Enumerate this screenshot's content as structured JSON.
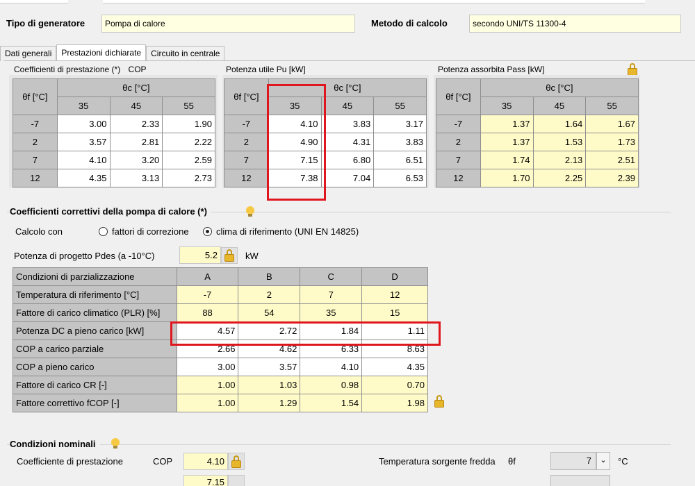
{
  "header": {
    "generator_label": "Tipo di generatore",
    "generator_value": "Pompa di calore",
    "method_label": "Metodo di calcolo",
    "method_value": "secondo UNI/TS 11300-4"
  },
  "tabs": [
    {
      "label": "Dati generali",
      "active": false
    },
    {
      "label": "Prestazioni dichiarate",
      "active": true
    },
    {
      "label": "Circuito in centrale",
      "active": false
    }
  ],
  "cop_table": {
    "title": "Coefficienti di prestazione (*)",
    "title_suffix": "COP",
    "row_header": "θf [°C]",
    "col_header": "θc [°C]",
    "cols": [
      "35",
      "45",
      "55"
    ],
    "rows": [
      {
        "label": "-7",
        "values": [
          "3.00",
          "2.33",
          "1.90"
        ]
      },
      {
        "label": "2",
        "values": [
          "3.57",
          "2.81",
          "2.22"
        ]
      },
      {
        "label": "7",
        "values": [
          "4.10",
          "3.20",
          "2.59"
        ]
      },
      {
        "label": "12",
        "values": [
          "4.35",
          "3.13",
          "2.73"
        ]
      }
    ]
  },
  "pu_table": {
    "title": "Potenza utile Pu [kW]",
    "row_header": "θf [°C]",
    "col_header": "θc [°C]",
    "cols": [
      "35",
      "45",
      "55"
    ],
    "rows": [
      {
        "label": "-7",
        "values": [
          "4.10",
          "3.83",
          "3.17"
        ]
      },
      {
        "label": "2",
        "values": [
          "4.90",
          "4.31",
          "3.83"
        ]
      },
      {
        "label": "7",
        "values": [
          "7.15",
          "6.80",
          "6.51"
        ]
      },
      {
        "label": "12",
        "values": [
          "7.38",
          "7.04",
          "6.53"
        ]
      }
    ]
  },
  "pass_table": {
    "title": "Potenza assorbita Pass [kW]",
    "row_header": "θf [°C]",
    "col_header": "θc [°C]",
    "cols": [
      "35",
      "45",
      "55"
    ],
    "rows": [
      {
        "label": "-7",
        "values": [
          "1.37",
          "1.64",
          "1.67"
        ]
      },
      {
        "label": "2",
        "values": [
          "1.37",
          "1.53",
          "1.73"
        ]
      },
      {
        "label": "7",
        "values": [
          "1.74",
          "2.13",
          "2.51"
        ]
      },
      {
        "label": "12",
        "values": [
          "1.70",
          "2.25",
          "2.39"
        ]
      }
    ]
  },
  "corrective": {
    "title": "Coefficienti correttivi della pompa di calore (*)",
    "calc_label": "Calcolo con",
    "option1": "fattori di correzione",
    "option2": "clima di riferimento (UNI EN 14825)",
    "selected_option": 2,
    "pdes_label": "Potenza di progetto Pdes (a -10°C)",
    "pdes_value": "5.2",
    "pdes_unit": "kW",
    "table": {
      "header_label": "Condizioni di parzializzazione",
      "cols": [
        "A",
        "B",
        "C",
        "D"
      ],
      "rows": [
        {
          "label": "Temperatura di riferimento [°C]",
          "values": [
            "-7",
            "2",
            "7",
            "12"
          ],
          "style": "yc"
        },
        {
          "label": "Fattore di carico climatico (PLR) [%]",
          "values": [
            "88",
            "54",
            "35",
            "15"
          ],
          "style": "yc"
        },
        {
          "label": "Potenza DC a pieno carico [kW]",
          "values": [
            "4.57",
            "2.72",
            "1.84",
            "1.11"
          ],
          "style": "wv"
        },
        {
          "label": "COP a carico parziale",
          "values": [
            "2.66",
            "4.62",
            "6.33",
            "8.63"
          ],
          "style": "wv"
        },
        {
          "label": "COP a pieno carico",
          "values": [
            "3.00",
            "3.57",
            "4.10",
            "4.35"
          ],
          "style": "wv"
        },
        {
          "label": "Fattore di carico CR [-]",
          "values": [
            "1.00",
            "1.03",
            "0.98",
            "0.70"
          ],
          "style": "yv"
        },
        {
          "label": "Fattore correttivo fCOP [-]",
          "values": [
            "1.00",
            "1.29",
            "1.54",
            "1.98"
          ],
          "style": "yv"
        }
      ]
    }
  },
  "nominal": {
    "title": "Condizioni nominali",
    "cop_label": "Coefficiente di prestazione",
    "cop_symbol": "COP",
    "cop_value": "4.10",
    "tsource_label": "Temperatura sorgente fredda",
    "tsource_symbol": "θf",
    "tsource_value": "7",
    "tsource_unit": "°C",
    "row2_left_value": "7.15"
  },
  "colors": {
    "highlight_red": "#e0161e",
    "input_yellow": "#fffbc8",
    "header_gray": "#c4c4c4"
  }
}
